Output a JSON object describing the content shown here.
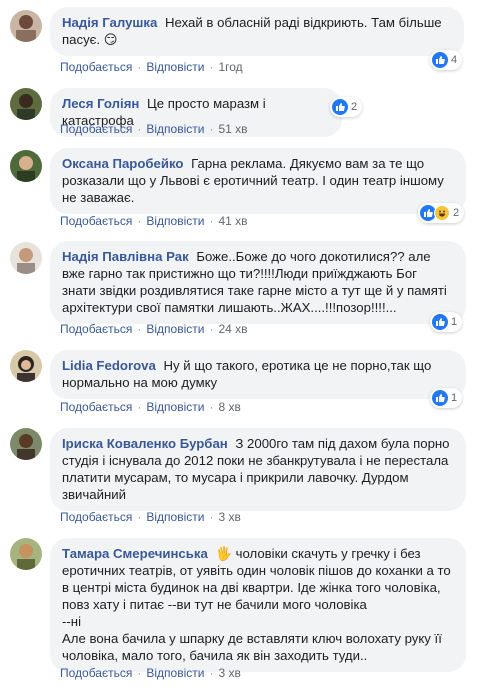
{
  "actions": {
    "like": "Подобається",
    "reply": "Відповісти",
    "sep": "·"
  },
  "comments": [
    {
      "author": "Надія Галушка",
      "text": "Нехай в обласній раді відкриють. Там більше пасує. 😏",
      "time": "1год",
      "reactions": "4"
    },
    {
      "author": "Леся Голіян",
      "text": "Це просто маразм і катастрофа",
      "time": "51 хв",
      "reactions": "2"
    },
    {
      "author": "Оксана Паробейко",
      "text": "Гарна реклама. Дякуємо вам за те що розказали що у Львові є еротичний театр. І один театр іншому не заважає.",
      "time": "41 хв",
      "reactions": "2"
    },
    {
      "author": "Надія Павлівна Рак",
      "text": "Боже..Боже до чого докотилися?? але вже гарно так пристижно що ти?!!!!Люди приїжджають Бог знати звідки роздивлятися таке гарне місто а тут ще й у памяті архітектури свої памятки лишають..ЖАХ....!!!позор!!!!...",
      "time": "24 хв",
      "reactions": "1"
    },
    {
      "author": "Lidia Fedorova",
      "text": "Ну й що такого, еротика це не порно,так що нормально на мою думку",
      "time": "8 хв",
      "reactions": "1"
    },
    {
      "author": "Іриска Коваленко Бурбан",
      "text": "З 2000го там під дахом була порно студія і існувала до 2012 поки не збанкрутувала і не перестала платити мусарам, то мусара і прикрили лавочку. Дурдом звичайний",
      "time": "3 хв",
      "reactions": ""
    },
    {
      "author": "Тамара Смеречинська",
      "text": "🖐 чоловіки скачуть у гречку і без еротичних театрів, от уявіть один чоловік пішов до коханки а то в центрі міста будинок на дві квартри. Іде жінка того чоловіка, повз хату і питає --ви тут не бачили мого чоловіка\n--ні\nАле вона бачила у шпарку де вставляти ключ волохату руку її чоловіка, мало того, бачила як він заходить туди..",
      "time": "3 хв",
      "reactions": ""
    }
  ],
  "colors": {
    "link": "#385898",
    "bubble": "#f2f3f5",
    "like": "#2078f4"
  }
}
